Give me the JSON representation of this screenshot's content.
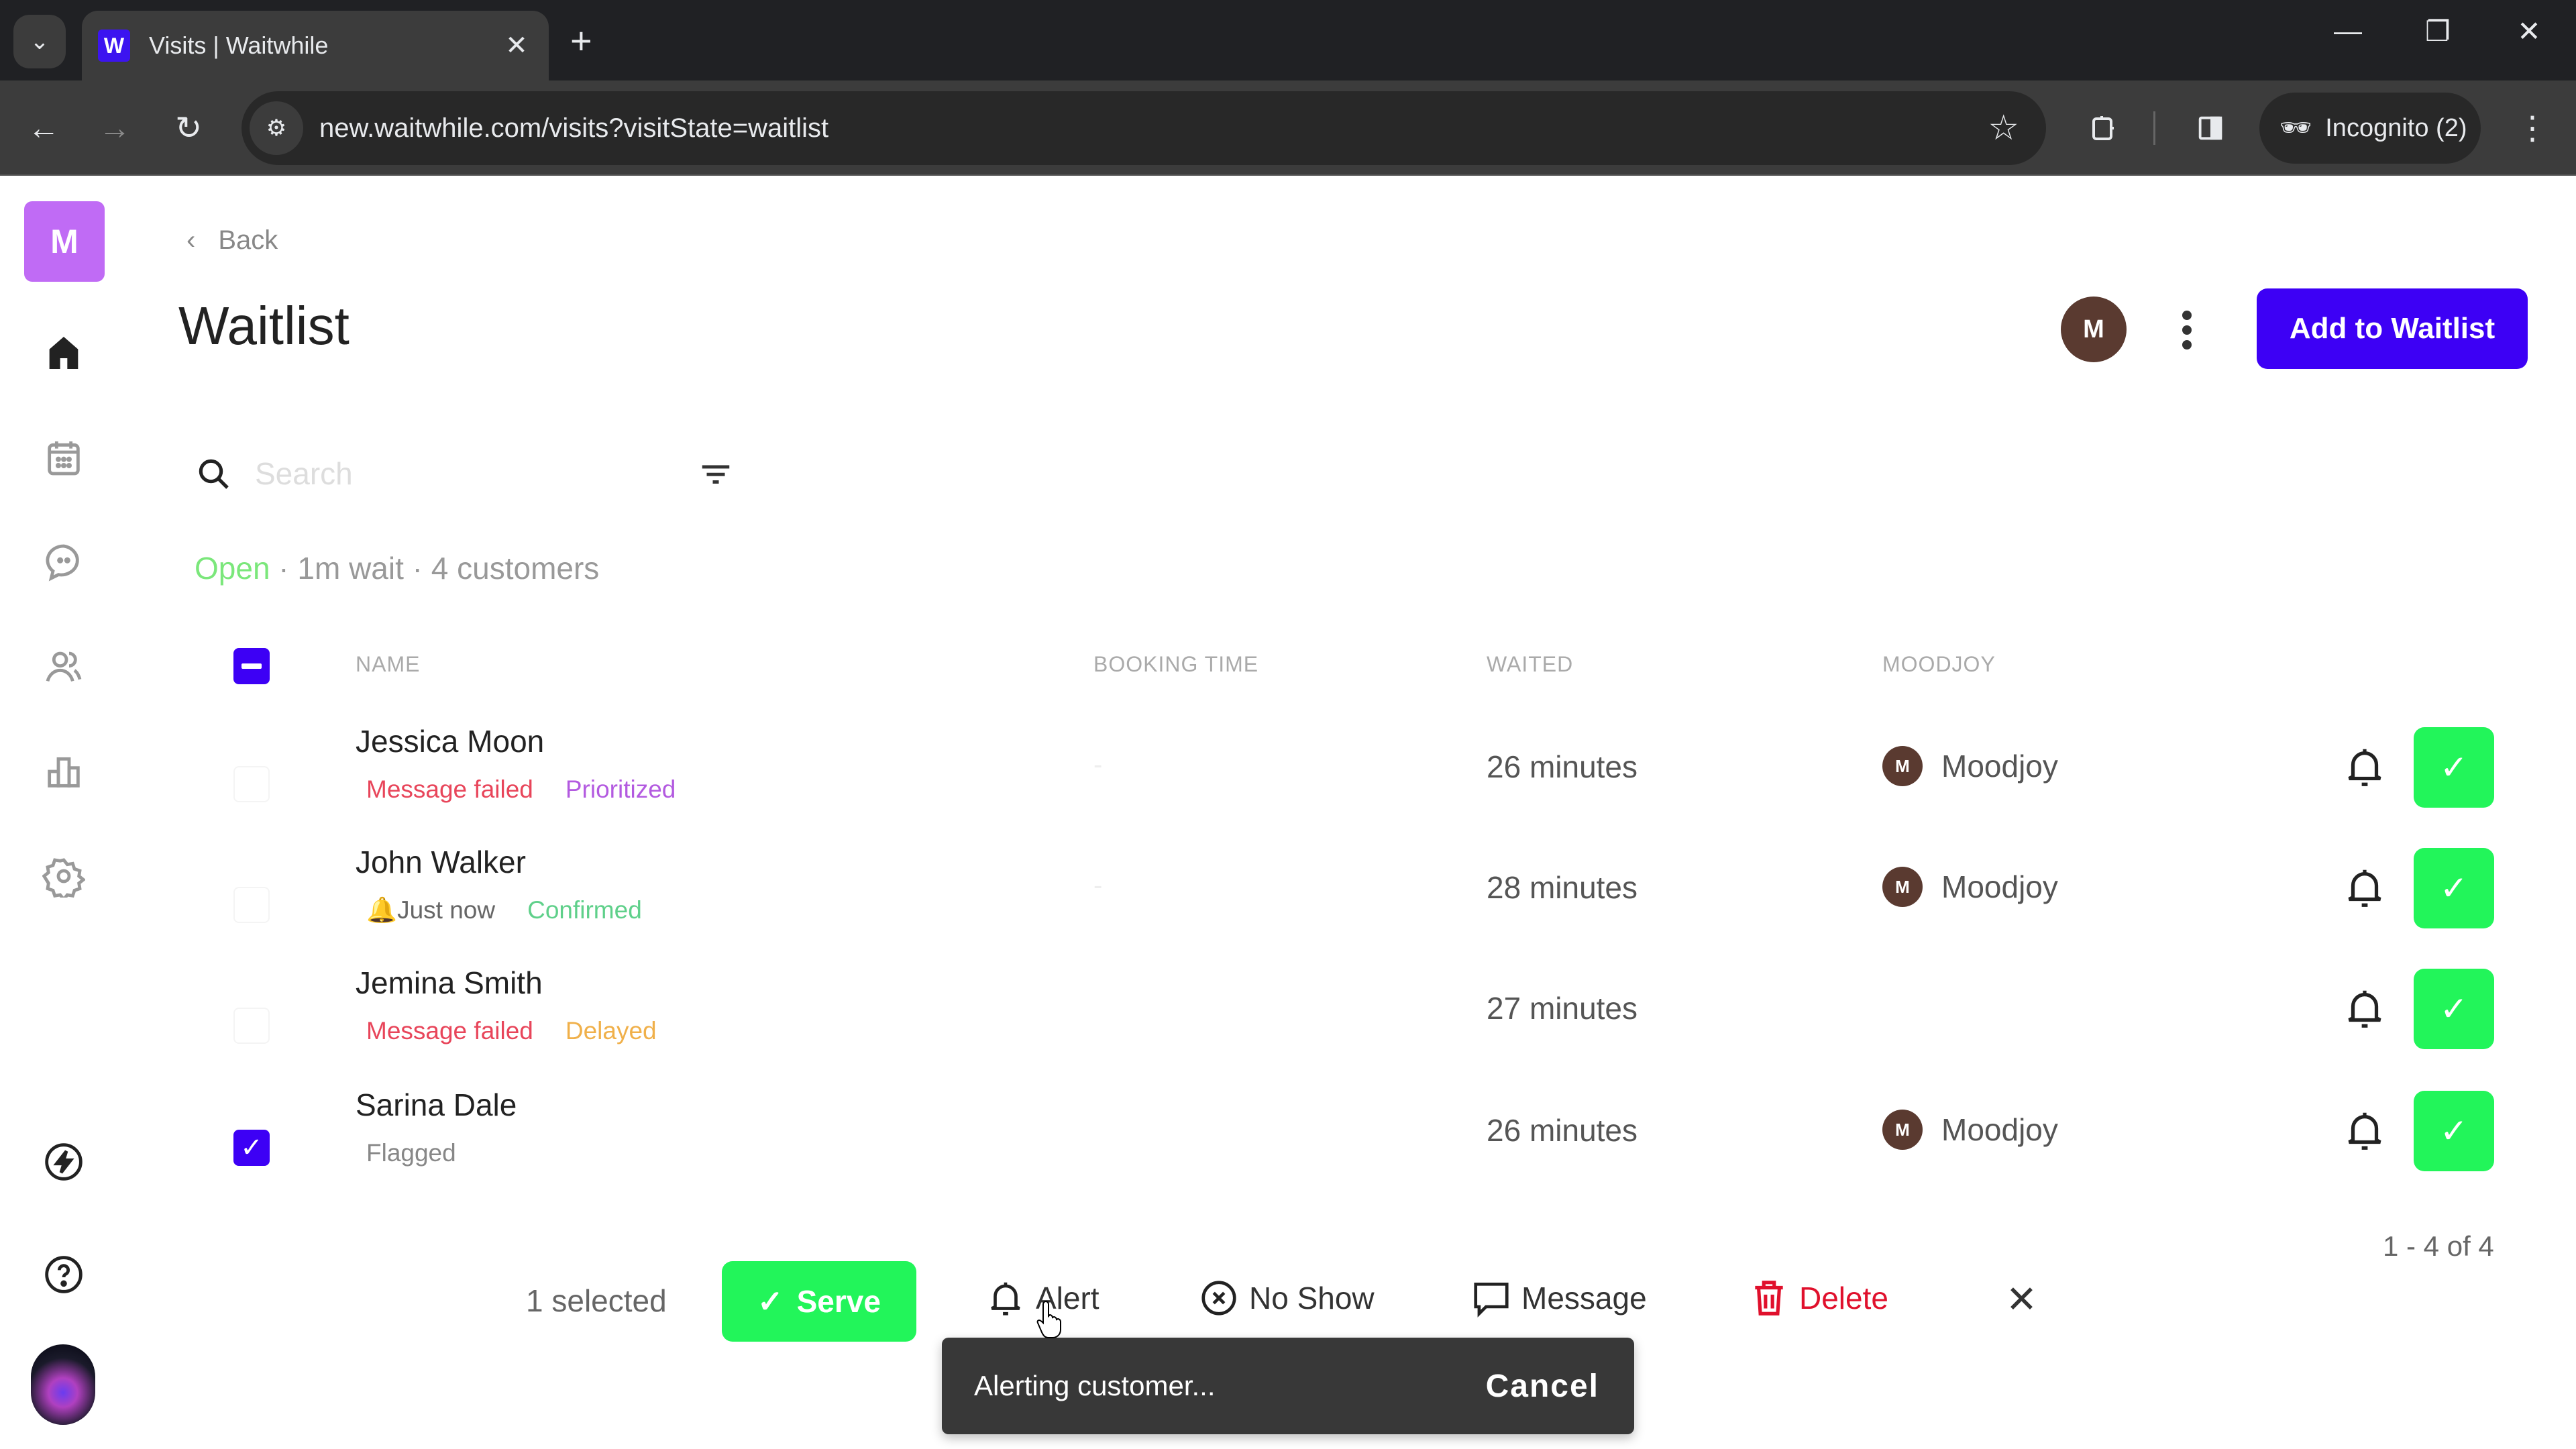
{
  "browser": {
    "tab_title": "Visits | Waitwhile",
    "url": "new.waitwhile.com/visits?visitState=waitlist",
    "incognito_label": "Incognito (2)"
  },
  "sidebar": {
    "org_initial": "M",
    "items": [
      {
        "name": "home",
        "icon": "home-icon",
        "active": true
      },
      {
        "name": "calendar",
        "icon": "calendar-icon"
      },
      {
        "name": "messages",
        "icon": "chat-icon"
      },
      {
        "name": "customers",
        "icon": "users-icon"
      },
      {
        "name": "analytics",
        "icon": "bar-chart-icon"
      },
      {
        "name": "settings",
        "icon": "gear-icon"
      }
    ],
    "bottom_items": [
      {
        "name": "whats-new",
        "icon": "lightning-icon"
      },
      {
        "name": "help",
        "icon": "help-icon"
      }
    ]
  },
  "header": {
    "back_label": "Back",
    "title": "Waitlist",
    "user_initial": "M",
    "add_button_label": "Add to Waitlist"
  },
  "search": {
    "placeholder": "Search",
    "value": ""
  },
  "status": {
    "state": "Open",
    "summary": " · 1m wait · 4 customers"
  },
  "table": {
    "columns": [
      "NAME",
      "BOOKING TIME",
      "WAITED",
      "MOODJOY"
    ],
    "rows": [
      {
        "name": "Jessica Moon",
        "checked": false,
        "tags": [
          {
            "label": "Message failed",
            "color": "#e8455a"
          },
          {
            "label": "Prioritized",
            "color": "#b35ae0"
          }
        ],
        "booking_time": "-",
        "waited": "26 minutes",
        "resource_initial": "M",
        "resource": "Moodjoy"
      },
      {
        "name": "John Walker",
        "checked": false,
        "tags": [
          {
            "label": "Just now",
            "color": "#666666",
            "icon": "bell-filled-icon"
          },
          {
            "label": "Confirmed",
            "color": "#5fd08a"
          }
        ],
        "booking_time": "-",
        "waited": "28 minutes",
        "resource_initial": "M",
        "resource": "Moodjoy"
      },
      {
        "name": "Jemina Smith",
        "checked": false,
        "tags": [
          {
            "label": "Message failed",
            "color": "#e8455a"
          },
          {
            "label": "Delayed",
            "color": "#f0b04a"
          }
        ],
        "booking_time": "",
        "waited": "27 minutes",
        "resource_initial": "",
        "resource": ""
      },
      {
        "name": "Sarina Dale",
        "checked": true,
        "tags": [
          {
            "label": "Flagged",
            "color": "#888888"
          }
        ],
        "booking_time": "",
        "waited": "26 minutes",
        "resource_initial": "M",
        "resource": "Moodjoy"
      }
    ],
    "pagination": "1 - 4 of 4"
  },
  "bulk_actions": {
    "selected_label": "1 selected",
    "serve_label": "Serve",
    "alert_label": "Alert",
    "no_show_label": "No Show",
    "message_label": "Message",
    "delete_label": "Delete"
  },
  "toast": {
    "message": "Alerting customer...",
    "action_label": "Cancel"
  },
  "colors": {
    "primary": "#3d00f5",
    "serve_green": "#22f55a",
    "danger": "#e0102c",
    "open_green": "#7be77b",
    "org_logo": "#c06bf5"
  }
}
